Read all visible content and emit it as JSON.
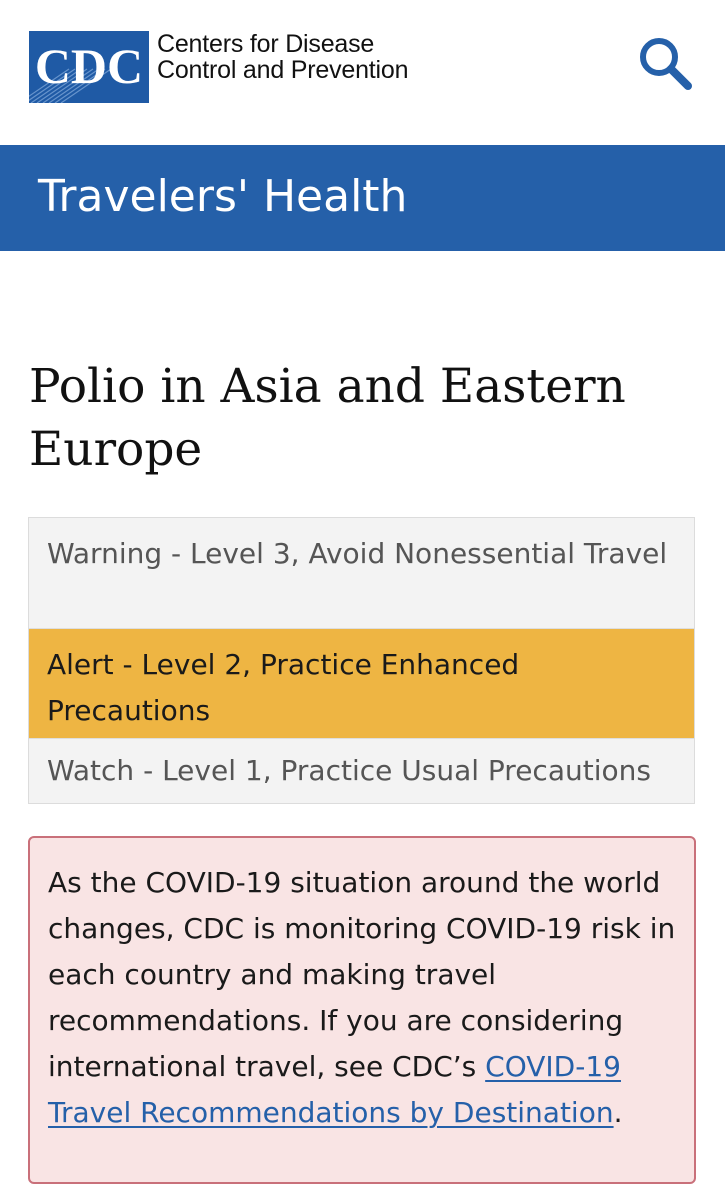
{
  "header": {
    "logo_text": "CDC",
    "org_name_line1": "Centers for Disease",
    "org_name_line2": "Control and Prevention",
    "search_icon": "search-icon"
  },
  "banner": {
    "title": "Travelers' Health"
  },
  "main": {
    "title": "Polio in Asia and Eastern Europe",
    "levels": [
      {
        "label": "Warning - Level 3, Avoid Nonessential Travel",
        "active": false
      },
      {
        "label": "Alert - Level 2, Practice Enhanced Precautions",
        "active": true
      },
      {
        "label": "Watch - Level 1, Practice Usual Precautions",
        "active": false
      }
    ],
    "notice": {
      "text_before_link": "As the COVID-19 situation around the world changes, CDC is monitoring COVID-19 risk in each country and making travel recommendations. If you are considering international travel, see CDC’s ",
      "link_text": "COVID-19 Travel Recommendations by Destination",
      "text_after_link": "."
    }
  },
  "colors": {
    "brand_blue": "#2560a9",
    "alert_amber": "#eeb543",
    "notice_bg": "#f9e4e4",
    "notice_border": "#c9707a"
  }
}
